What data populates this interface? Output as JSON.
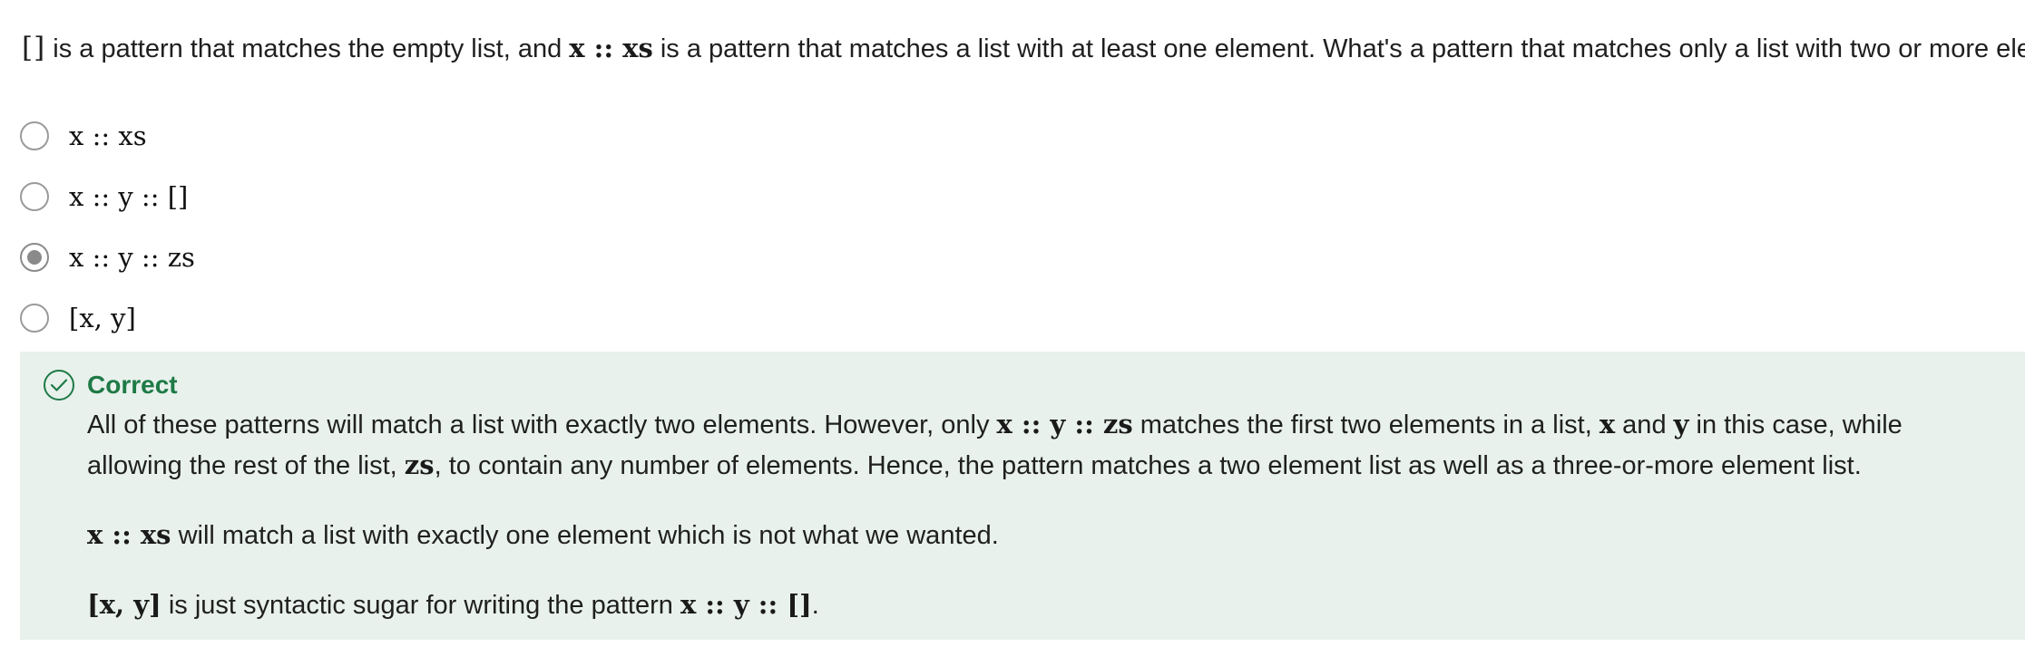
{
  "question": {
    "empty_list": "[]",
    "text_1": " is a pattern that matches the empty list, and ",
    "pattern_cons": "x :: xs",
    "text_2": " is a pattern that matches a list with at least one element.  What's a pattern that matches only a list with two or more elements?"
  },
  "options": [
    {
      "label": "x :: xs",
      "selected": false
    },
    {
      "label": "x :: y :: []",
      "selected": false
    },
    {
      "label": "x :: y :: zs",
      "selected": true
    },
    {
      "label": "[x, y]",
      "selected": false
    }
  ],
  "feedback": {
    "status": "Correct",
    "status_color": "#1e7a46",
    "background": "#e8f1ec",
    "icon": "check-circle-icon",
    "p1_a": "All of these patterns will match a list with exactly two elements.  However, only ",
    "p1_code1": "x :: y :: zs",
    "p1_b": " matches the first two elements in a list, ",
    "p1_code2": "x",
    "p1_c": " and ",
    "p1_code3": "y",
    "p1_d": " in this case, while allowing the rest of the list, ",
    "p1_code4": "zs",
    "p1_e": ", to contain any number of elements.  Hence, the pattern matches a two element list as well as a three-or-more element list.",
    "p2_code": "x :: xs",
    "p2_text": " will match a list with exactly one element which is not what we wanted.",
    "p3_code": "[x, y]",
    "p3_text": " is just syntactic sugar for writing the pattern ",
    "p3_code2": "x :: y :: []",
    "p3_end": "."
  }
}
